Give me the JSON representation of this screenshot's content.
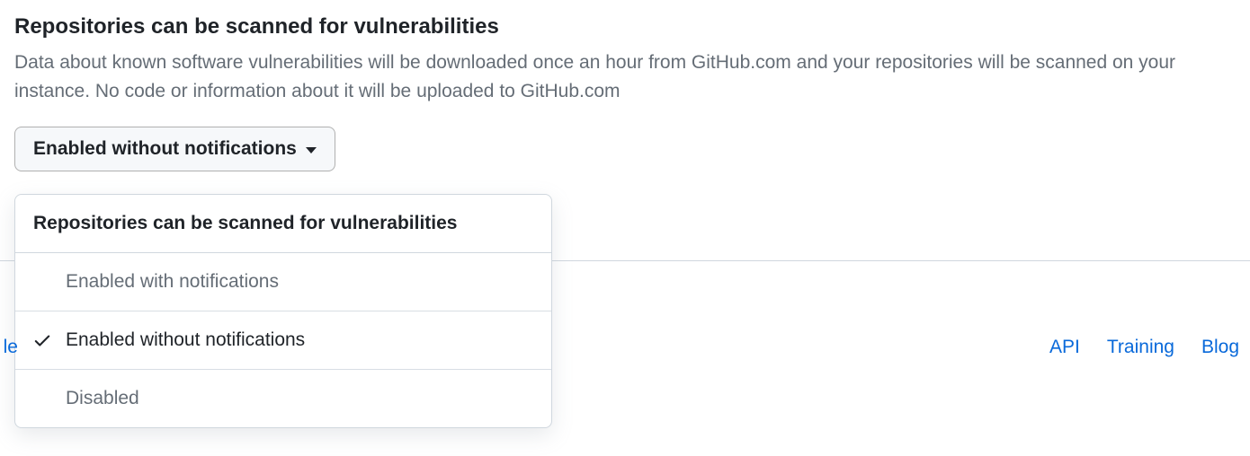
{
  "section": {
    "title": "Repositories can be scanned for vulnerabilities",
    "description": "Data about known software vulnerabilities will be downloaded once an hour from GitHub.com and your repositories will be scanned on your instance. No code or information about it will be uploaded to GitHub.com"
  },
  "dropdown": {
    "selected_label": "Enabled without notifications",
    "menu_header": "Repositories can be scanned for vulnerabilities",
    "options": [
      {
        "label": "Enabled with notifications",
        "selected": false
      },
      {
        "label": "Enabled without notifications",
        "selected": true
      },
      {
        "label": "Disabled",
        "selected": false
      }
    ]
  },
  "footer": {
    "left_partial": "le",
    "links": [
      {
        "label": "API"
      },
      {
        "label": "Training"
      },
      {
        "label": "Blog"
      }
    ]
  }
}
